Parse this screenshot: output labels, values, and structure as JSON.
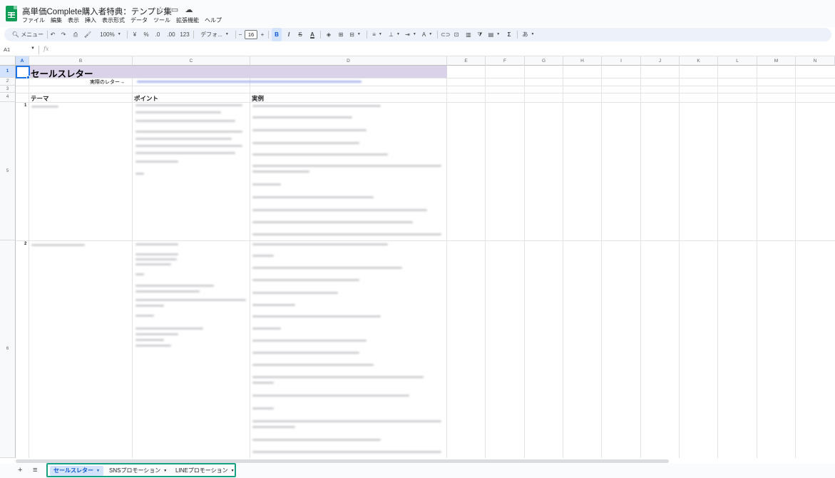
{
  "title_bar": {
    "document_title": "高単価Complete購入者特典：テンプレ集",
    "icons": [
      "star-icon",
      "folder-icon",
      "cloud-icon"
    ]
  },
  "menu": [
    "ファイル",
    "編集",
    "表示",
    "挿入",
    "表示形式",
    "データ",
    "ツール",
    "拡張機能",
    "ヘルプ"
  ],
  "toolbar": {
    "menu_search": "メニュー",
    "zoom": "100%",
    "currency": "¥",
    "percent": "%",
    "decrease_decimal": ".0",
    "increase_decimal": ".00",
    "number_format": "123",
    "font": "デフォ...",
    "font_size": "16",
    "bold": "B",
    "italic": "I",
    "text_color": "A",
    "sum": "Σ",
    "input_tools": "あ"
  },
  "formula_bar": {
    "cell_ref": "A1",
    "fx": "fx"
  },
  "columns": [
    "A",
    "B",
    "C",
    "D",
    "E",
    "F",
    "G",
    "H",
    "I",
    "J",
    "K",
    "L",
    "M",
    "N"
  ],
  "rows": [
    "1",
    "2",
    "3",
    "4",
    "5",
    "6"
  ],
  "sheet": {
    "title": "セールスレター",
    "example_label": "実際のレター→",
    "headers": {
      "theme": "テーマ",
      "point": "ポイント",
      "example": "実例"
    },
    "row_numbers": [
      "1",
      "2"
    ]
  },
  "tabs": [
    {
      "label": "セールスレター",
      "active": true
    },
    {
      "label": "SNSプロモーション",
      "active": false
    },
    {
      "label": "LINEプロモーション",
      "active": false
    }
  ],
  "colors": {
    "accent": "#1a73e8",
    "header_band": "#d9d2e9",
    "sheets_green": "#0f9d58",
    "tab_outline": "#16a085"
  }
}
